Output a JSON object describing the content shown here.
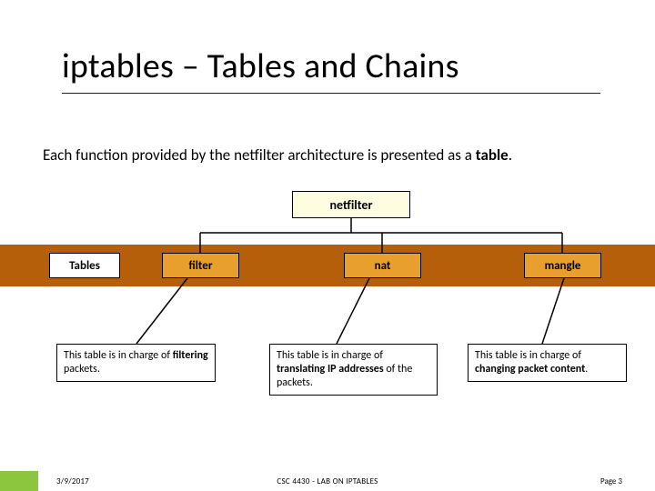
{
  "title": "iptables – Tables and Chains",
  "subtitle_before": "Each function provided by the netfilter architecture is presented as a ",
  "subtitle_bold": "table",
  "subtitle_after": ".",
  "root_box": "netfilter",
  "tables_label": "Tables",
  "nodes": {
    "filter": "filter",
    "nat": "nat",
    "mangle": "mangle"
  },
  "descriptions": {
    "filter_before": "This table is in charge of ",
    "filter_bold": "filtering",
    "filter_after": " packets.",
    "nat_before": "This table is in charge of ",
    "nat_bold": "translating IP addresses",
    "nat_after": " of the packets.",
    "mangle_before": "This table is in charge of ",
    "mangle_bold": "changing packet content",
    "mangle_after": "."
  },
  "footer": {
    "date": "3/9/2017",
    "center": "CSC 4430 - LAB ON IPTABLES",
    "page": "Page 3"
  }
}
